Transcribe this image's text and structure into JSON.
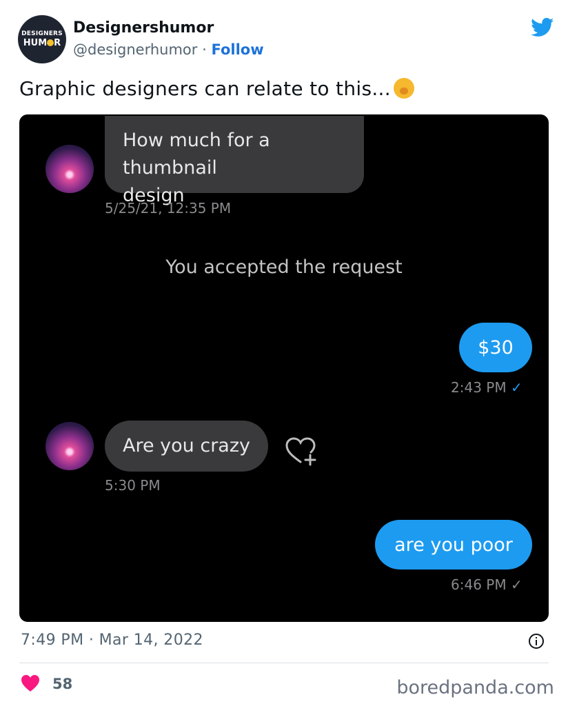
{
  "tweet": {
    "avatar_line1": "DESIGNERS",
    "avatar_line2": "HUM",
    "avatar_line2_end": "R",
    "author_name": "Designershumor",
    "handle": "@designerhumor",
    "separator": "·",
    "follow_label": "Follow",
    "text": "Graphic designers can relate to this...",
    "timestamp": "7:49 PM · Mar 14, 2022",
    "like_count": "58",
    "source": "boredpanda.com"
  },
  "conversation": {
    "msg1_line1": "How much for a thumbnail",
    "msg1_line2": "design",
    "msg1_time": "5/25/21, 12:35 PM",
    "system_text": "You accepted the request",
    "msg2": "$30",
    "msg2_time": "2:43 PM",
    "msg3": "Are you crazy",
    "msg3_time": "5:30 PM",
    "msg4": "are you poor",
    "msg4_time": "6:46 PM",
    "checkmark": "✓"
  },
  "colors": {
    "accent_blue": "#1d9bf0",
    "link_blue": "#1d72d8",
    "heart_pink": "#f91880",
    "dm_background": "#000000",
    "incoming_bubble": "#3a3a3c"
  }
}
